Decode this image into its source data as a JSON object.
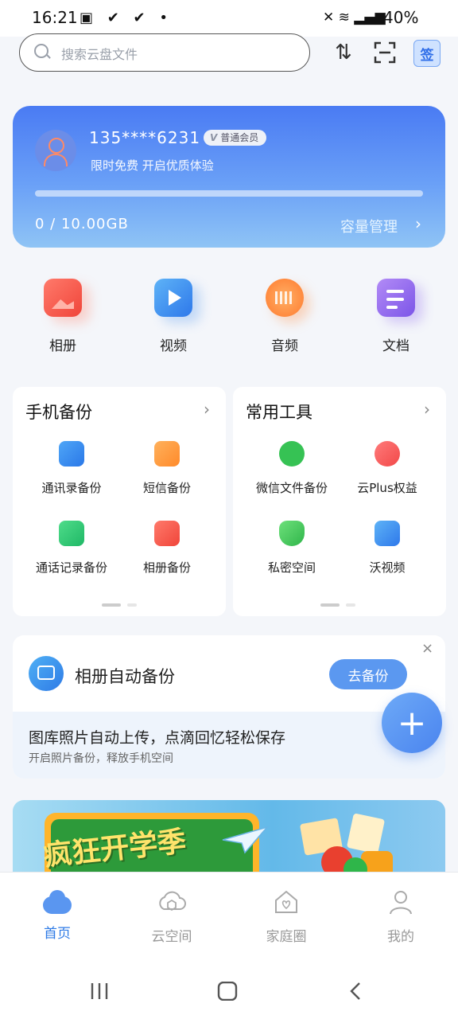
{
  "status_bar": {
    "time": "16:21",
    "battery": "40%"
  },
  "header": {
    "search_placeholder": "搜索云盘文件",
    "sign_label": "签"
  },
  "member": {
    "phone": "135****6231",
    "badge": "普通会员",
    "promo": "限时免费 开启优质体验",
    "capacity": "0 / 10.00GB",
    "used_fraction": 0,
    "manage_label": "容量管理"
  },
  "categories": [
    {
      "label": "相册",
      "icon": "album-icon"
    },
    {
      "label": "视频",
      "icon": "video-icon"
    },
    {
      "label": "音频",
      "icon": "audio-icon"
    },
    {
      "label": "文档",
      "icon": "document-icon"
    }
  ],
  "backup_panel": {
    "title": "手机备份",
    "items": [
      {
        "label": "通讯录备份",
        "icon": "contacts-icon"
      },
      {
        "label": "短信备份",
        "icon": "sms-icon"
      },
      {
        "label": "通话记录备份",
        "icon": "call-log-icon"
      },
      {
        "label": "相册备份",
        "icon": "photo-icon"
      }
    ]
  },
  "tools_panel": {
    "title": "常用工具",
    "items": [
      {
        "label": "微信文件备份",
        "icon": "wechat-icon"
      },
      {
        "label": "云Plus权益",
        "icon": "ribbon-icon"
      },
      {
        "label": "私密空间",
        "icon": "shield-icon"
      },
      {
        "label": "沃视频",
        "icon": "play-icon"
      }
    ]
  },
  "auto_backup": {
    "title": "相册自动备份",
    "button": "去备份",
    "line1": "图库照片自动上传，点滴回忆轻松保存",
    "line2": "开启照片备份，释放手机空间"
  },
  "banner": {
    "text": "疯狂开学季"
  },
  "nav": [
    {
      "label": "首页",
      "icon": "home-cloud-icon",
      "active": true
    },
    {
      "label": "云空间",
      "icon": "cloud-box-icon",
      "active": false
    },
    {
      "label": "家庭圈",
      "icon": "family-home-icon",
      "active": false
    },
    {
      "label": "我的",
      "icon": "profile-icon",
      "active": false
    }
  ],
  "colors": {
    "accent": "#2f7be6",
    "card_top": "#4a7bf3",
    "card_bottom": "#8fc4f5"
  }
}
